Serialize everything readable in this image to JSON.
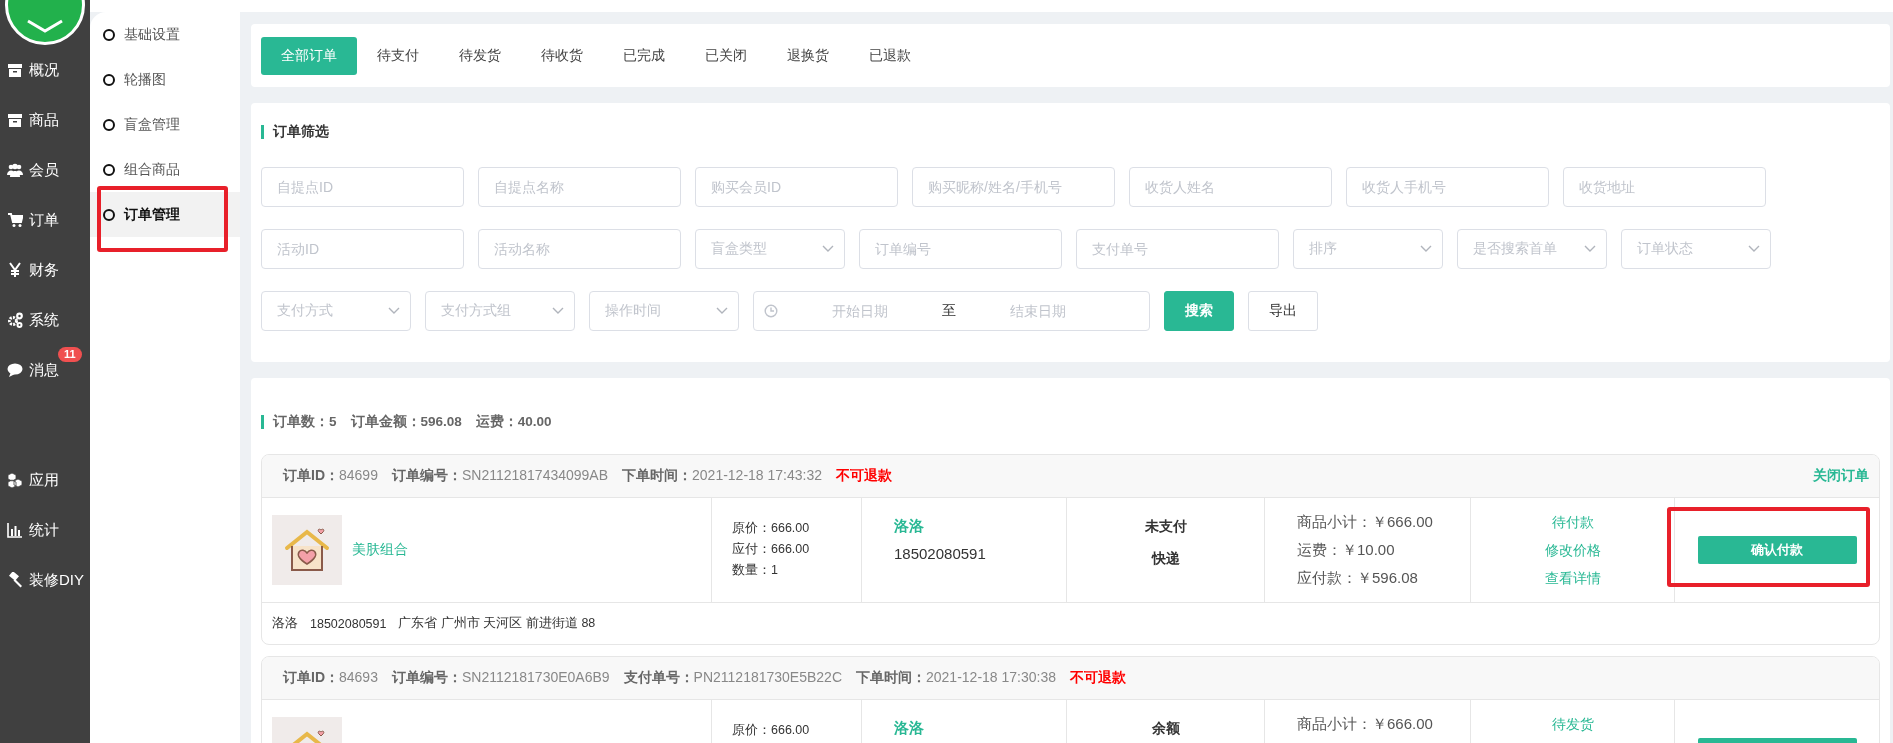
{
  "nav": {
    "main_items": [
      {
        "label": "概况"
      },
      {
        "label": "商品"
      },
      {
        "label": "会员"
      },
      {
        "label": "订单"
      },
      {
        "label": "财务"
      },
      {
        "label": "系统"
      },
      {
        "label": "消息",
        "badge": "11"
      }
    ],
    "extra_items": [
      {
        "label": "应用"
      },
      {
        "label": "统计"
      },
      {
        "label": "装修DIY"
      }
    ]
  },
  "sub_nav": {
    "items": [
      {
        "label": "基础设置",
        "selected": false,
        "highlighted": false
      },
      {
        "label": "轮播图",
        "selected": false,
        "highlighted": false
      },
      {
        "label": "盲盒管理",
        "selected": false,
        "highlighted": false
      },
      {
        "label": "组合商品",
        "selected": false,
        "highlighted": false
      },
      {
        "label": "订单管理",
        "selected": true,
        "highlighted": true
      }
    ]
  },
  "tabs": [
    {
      "label": "全部订单",
      "selected": true
    },
    {
      "label": "待支付",
      "selected": false
    },
    {
      "label": "待发货",
      "selected": false
    },
    {
      "label": "待收货",
      "selected": false
    },
    {
      "label": "已完成",
      "selected": false
    },
    {
      "label": "已关闭",
      "selected": false
    },
    {
      "label": "退换货",
      "selected": false
    },
    {
      "label": "已退款",
      "selected": false
    }
  ],
  "filter": {
    "title": "订单筛选",
    "rows": [
      [
        {
          "kind": "input",
          "placeholder": "自提点ID"
        },
        {
          "kind": "input",
          "placeholder": "自提点名称"
        },
        {
          "kind": "input",
          "placeholder": "购买会员ID"
        },
        {
          "kind": "input",
          "placeholder": "购买昵称/姓名/手机号"
        },
        {
          "kind": "input",
          "placeholder": "收货人姓名"
        },
        {
          "kind": "input",
          "placeholder": "收货人手机号"
        },
        {
          "kind": "input",
          "placeholder": "收货地址"
        }
      ],
      [
        {
          "kind": "input",
          "placeholder": "活动ID"
        },
        {
          "kind": "input",
          "placeholder": "活动名称"
        },
        {
          "kind": "select",
          "placeholder": "盲盒类型"
        },
        {
          "kind": "input",
          "placeholder": "订单编号"
        },
        {
          "kind": "input",
          "placeholder": "支付单号"
        },
        {
          "kind": "select",
          "placeholder": "排序"
        },
        {
          "kind": "select",
          "placeholder": "是否搜索首单"
        },
        {
          "kind": "select",
          "placeholder": "订单状态"
        }
      ],
      [
        {
          "kind": "select",
          "placeholder": "支付方式"
        },
        {
          "kind": "select",
          "placeholder": "支付方式组"
        },
        {
          "kind": "select",
          "placeholder": "操作时间"
        },
        {
          "kind": "daterange",
          "start_placeholder": "开始日期",
          "separator": "至",
          "end_placeholder": "结束日期"
        }
      ]
    ],
    "buttons": [
      {
        "kind": "primary",
        "label": "搜索"
      },
      {
        "kind": "default",
        "label": "导出"
      }
    ]
  },
  "summary": {
    "stats": [
      "订单数：5",
      "订单金额：596.08",
      "运费：40.00"
    ]
  },
  "orders": [
    {
      "meta": [
        "**订单ID：**84699",
        "**订单编号：**SN21121817434099AB",
        "**下单时间：**2021-12-18 17:43:32"
      ],
      "refund_note": "不可退款",
      "close_link": "关闭订单",
      "product": {
        "name": "美肤组合"
      },
      "pricing": [
        "原价：666.00",
        "应付：666.00",
        "数量：1"
      ],
      "buyer": {
        "name": "洛洛",
        "phone": "18502080591"
      },
      "payment": [
        "未支付",
        "快递"
      ],
      "amounts": [
        "商品小计：￥666.00",
        "运费：￥10.00",
        "应付款：￥596.08"
      ],
      "links": [
        "待付款",
        "修改价格",
        "查看详情"
      ],
      "action": {
        "label": "确认付款",
        "highlighted": true
      },
      "address": [
        "洛洛",
        "18502080591",
        "广东省 广州市 天河区 前进街道 88"
      ]
    },
    {
      "meta": [
        "**订单ID：**84693",
        "**订单编号：**SN2112181730E0A6B9",
        "**支付单号：**PN2112181730E5B22C",
        "**下单时间：**2021-12-18 17:30:38"
      ],
      "refund_note": "不可退款",
      "pricing": [
        "原价：666.00"
      ],
      "buyer": {
        "name": "洛洛"
      },
      "payment": [
        "余额"
      ],
      "amounts": [
        "商品小计：￥666.00"
      ],
      "links": [
        "待发货"
      ]
    }
  ]
}
